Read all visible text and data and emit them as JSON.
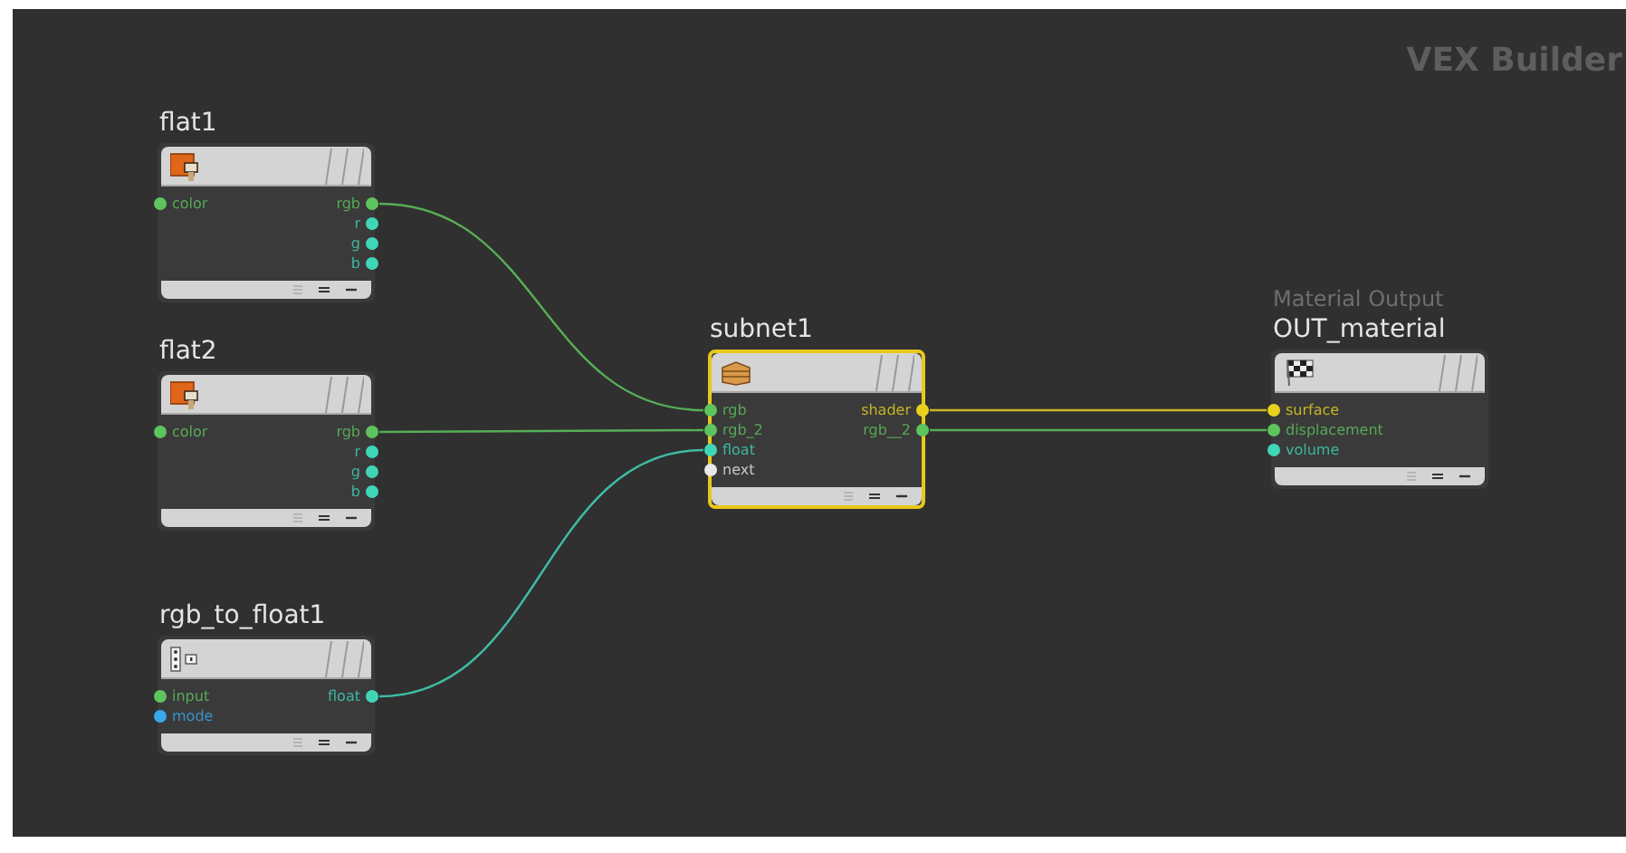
{
  "context_label": "VEX Builder",
  "nodes": [
    {
      "name": "flat1",
      "kind": "flat",
      "selected": false,
      "inputs": [
        {
          "label": "color",
          "color": "#5ec45e"
        }
      ],
      "outputs": [
        {
          "label": "rgb",
          "color": "#5ec45e"
        },
        {
          "label": "r",
          "color": "#3fd6b8"
        },
        {
          "label": "g",
          "color": "#3fd6b8"
        },
        {
          "label": "b",
          "color": "#3fd6b8"
        }
      ]
    },
    {
      "name": "flat2",
      "kind": "flat",
      "selected": false,
      "inputs": [
        {
          "label": "color",
          "color": "#5ec45e"
        }
      ],
      "outputs": [
        {
          "label": "rgb",
          "color": "#5ec45e"
        },
        {
          "label": "r",
          "color": "#3fd6b8"
        },
        {
          "label": "g",
          "color": "#3fd6b8"
        },
        {
          "label": "b",
          "color": "#3fd6b8"
        }
      ]
    },
    {
      "name": "rgb_to_float1",
      "kind": "convert",
      "selected": false,
      "inputs": [
        {
          "label": "input",
          "color": "#5ec45e"
        },
        {
          "label": "mode",
          "color": "#38a8ec"
        }
      ],
      "outputs": [
        {
          "label": "float",
          "color": "#3fd6b8"
        }
      ]
    },
    {
      "name": "subnet1",
      "kind": "subnet",
      "selected": true,
      "inputs": [
        {
          "label": "rgb",
          "color": "#5ec45e"
        },
        {
          "label": "rgb_2",
          "color": "#5ec45e"
        },
        {
          "label": "float",
          "color": "#3fd6b8"
        },
        {
          "label": "next",
          "color": "#e8e8e8"
        }
      ],
      "outputs": [
        {
          "label": "shader",
          "color": "#e8d21e"
        },
        {
          "label": "rgb__2",
          "color": "#5ec45e"
        }
      ]
    },
    {
      "subtitle": "Material Output",
      "name": "OUT_material",
      "kind": "output",
      "selected": false,
      "inputs": [
        {
          "label": "surface",
          "color": "#e8d21e"
        },
        {
          "label": "displacement",
          "color": "#5ec45e"
        },
        {
          "label": "volume",
          "color": "#3fd6b8"
        }
      ]
    }
  ]
}
